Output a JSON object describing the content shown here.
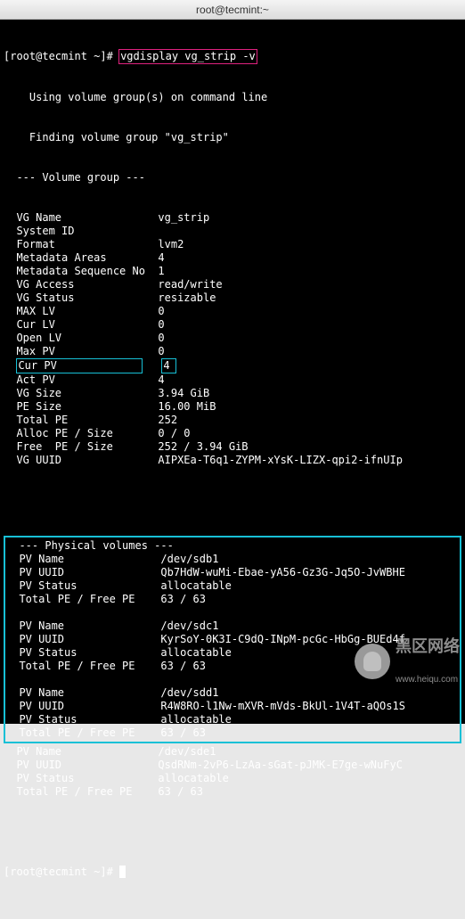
{
  "titlebar": "root@tecmint:~",
  "prompt": "[root@tecmint ~]#",
  "command": "vgdisplay vg_strip -v",
  "msg_using": "  Using volume group(s) on command line",
  "msg_finding": "  Finding volume group \"vg_strip\"",
  "header_vg": "--- Volume group ---",
  "vg": {
    "rows": [
      {
        "label": "VG Name",
        "value": "vg_strip"
      },
      {
        "label": "System ID",
        "value": ""
      },
      {
        "label": "Format",
        "value": "lvm2"
      },
      {
        "label": "Metadata Areas",
        "value": "4"
      },
      {
        "label": "Metadata Sequence No",
        "value": "1"
      },
      {
        "label": "VG Access",
        "value": "read/write"
      },
      {
        "label": "VG Status",
        "value": "resizable"
      },
      {
        "label": "MAX LV",
        "value": "0"
      },
      {
        "label": "Cur LV",
        "value": "0"
      },
      {
        "label": "Open LV",
        "value": "0"
      },
      {
        "label": "Max PV",
        "value": "0"
      },
      {
        "label": "Cur PV",
        "value": "4",
        "hi": true
      },
      {
        "label": "Act PV",
        "value": "4"
      },
      {
        "label": "VG Size",
        "value": "3.94 GiB"
      },
      {
        "label": "PE Size",
        "value": "16.00 MiB"
      },
      {
        "label": "Total PE",
        "value": "252"
      },
      {
        "label": "Alloc PE / Size",
        "value": "0 / 0"
      },
      {
        "label": "Free  PE / Size",
        "value": "252 / 3.94 GiB"
      },
      {
        "label": "VG UUID",
        "value": "AIPXEa-T6q1-ZYPM-xYsK-LIZX-qpi2-ifnUIp"
      }
    ]
  },
  "header_pv": "--- Physical volumes ---",
  "pv_labels": {
    "name": "PV Name",
    "uuid": "PV UUID",
    "status": "PV Status",
    "pe": "Total PE / Free PE"
  },
  "pvs": [
    {
      "name": "/dev/sdb1",
      "uuid": "Qb7HdW-wuMi-Ebae-yA56-Gz3G-Jq5O-JvWBHE",
      "status": "allocatable",
      "pe": "63 / 63"
    },
    {
      "name": "/dev/sdc1",
      "uuid": "KyrSoY-0K3I-C9dQ-INpM-pcGc-HbGg-BUEd4f",
      "status": "allocatable",
      "pe": "63 / 63"
    },
    {
      "name": "/dev/sdd1",
      "uuid": "R4W8RO-l1Nw-mXVR-mVds-BkUl-1V4T-aQOs1S",
      "status": "allocatable",
      "pe": "63 / 63"
    },
    {
      "name": "/dev/sde1",
      "uuid": "QsdRNm-2vP6-LzAa-sGat-pJMK-E7ge-wNuFyC",
      "status": "allocatable",
      "pe": "63 / 63"
    }
  ],
  "watermark": {
    "cn": "黑区网络",
    "en": "www.heiqu.com"
  }
}
